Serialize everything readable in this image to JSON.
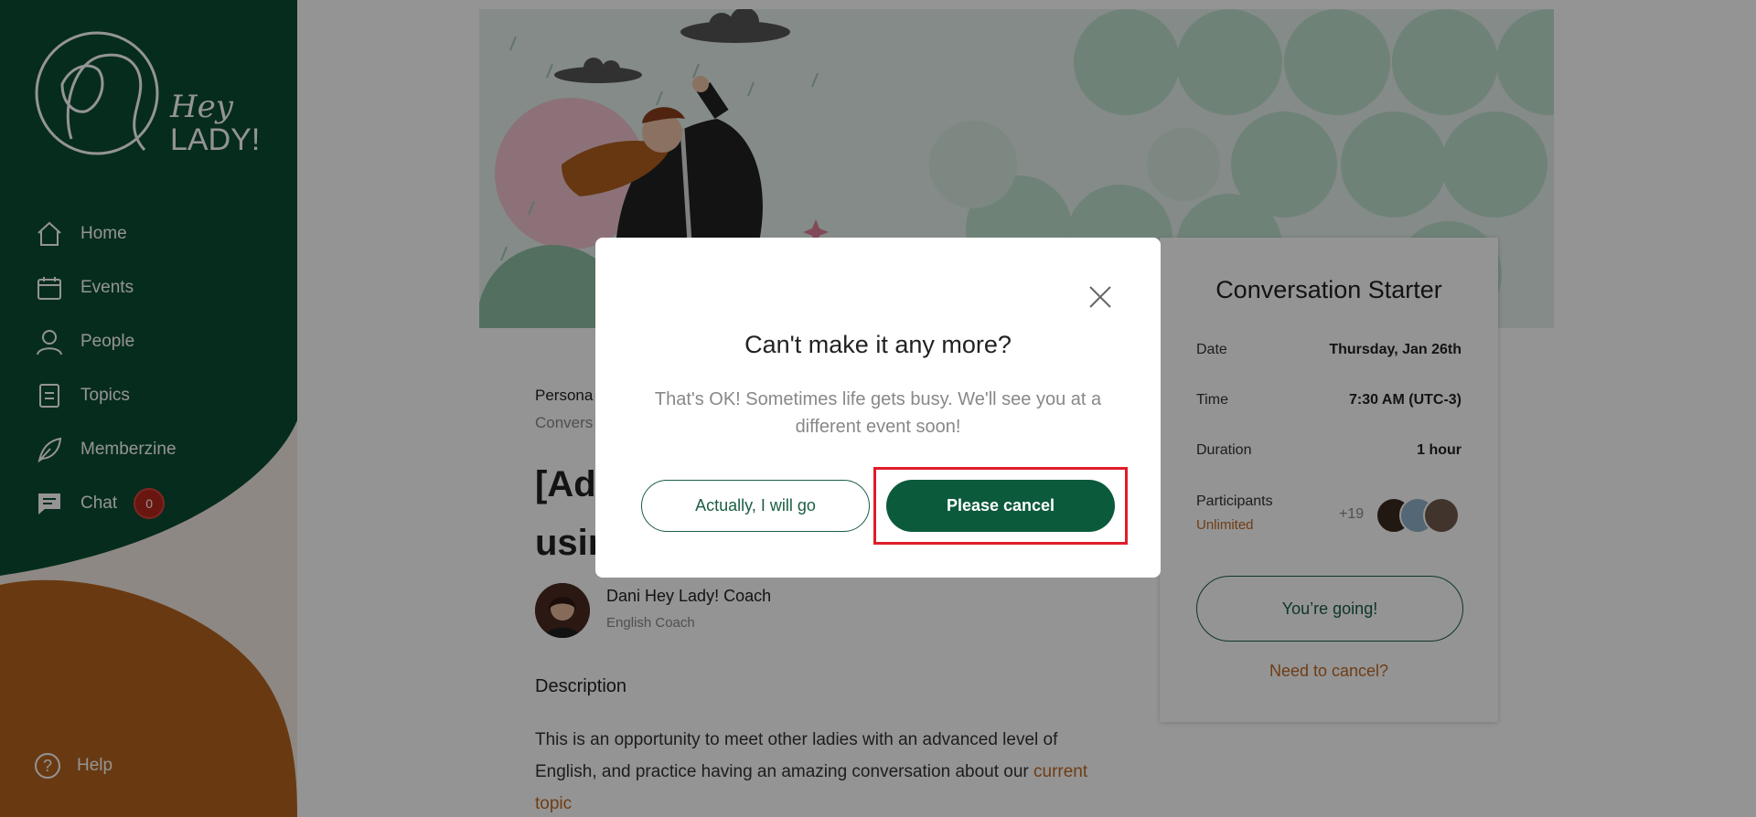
{
  "sidebar": {
    "logo_text_line1": "Hey",
    "logo_text_line2": "LADY!",
    "items": [
      {
        "label": "Home",
        "icon": "home-icon"
      },
      {
        "label": "Events",
        "icon": "calendar-icon"
      },
      {
        "label": "People",
        "icon": "person-icon"
      },
      {
        "label": "Topics",
        "icon": "document-icon"
      },
      {
        "label": "Memberzine",
        "icon": "leaf-icon"
      },
      {
        "label": "Chat",
        "icon": "chat-icon",
        "badge": "0"
      }
    ],
    "help_label": "Help",
    "help_icon": "?"
  },
  "event": {
    "meta_line1": "Persona",
    "meta_line2": "Convers",
    "title_line1": "[Ad",
    "title_line2": "usir",
    "host_name": "Dani Hey Lady! Coach",
    "host_role": "English Coach",
    "description_heading": "Description",
    "description_text": "This is an opportunity to meet other ladies with an advanced level of English, and practice having an amazing conversation about our ",
    "description_link": "current topic"
  },
  "card": {
    "title": "Conversation Starter",
    "date_label": "Date",
    "date_value": "Thursday, Jan 26th",
    "time_label": "Time",
    "time_value": "7:30 AM (UTC-3)",
    "duration_label": "Duration",
    "duration_value": "1 hour",
    "participants_label": "Participants",
    "participants_sub": "Unlimited",
    "participants_more": "+19",
    "going_button": "You’re going!",
    "need_cancel_link": "Need to cancel?"
  },
  "modal": {
    "title": "Can't make it any more?",
    "text": "That's OK! Sometimes life gets busy. We'll see you at a different event soon!",
    "go_button": "Actually, I will go",
    "cancel_button": "Please cancel"
  },
  "colors": {
    "brand_green": "#0b5a3c",
    "accent_orange": "#c06a25",
    "badge_red": "#b5261e",
    "highlight_red": "#e01c2a"
  }
}
